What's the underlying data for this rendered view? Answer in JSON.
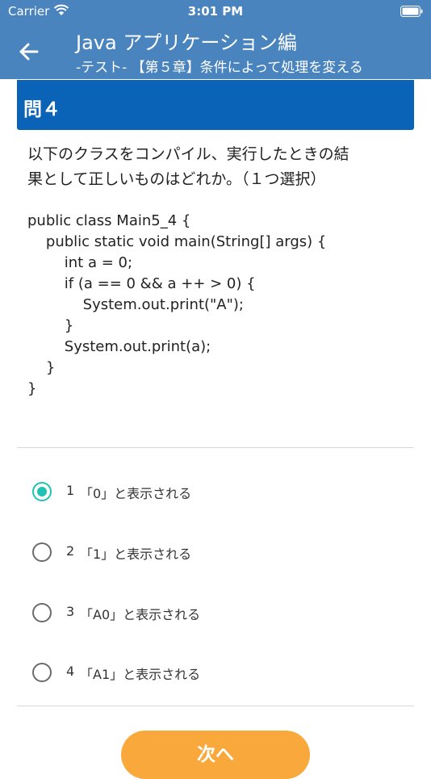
{
  "status_bar": {
    "carrier": "Carrier",
    "time": "3:01 PM",
    "icons": [
      "wifi-icon",
      "battery-icon"
    ]
  },
  "header": {
    "title": "Java アプリケーション編",
    "subtitle": "-テスト- 【第５章】条件によって処理を変える",
    "back_icon": "arrow-left-icon",
    "background": "#4a84be"
  },
  "question": {
    "label": "問４",
    "banner_color": "#0b63b8",
    "text_line1": "以下のクラスをコンパイル、実行したときの結",
    "text_line2": "果として正しいものはどれか。（１つ選択）",
    "code": [
      "public class Main5_4 {",
      "    public static void main(String[] args) {",
      "        int a = 0;",
      "        if (a == 0 && a ++ > 0) {",
      "            System.out.print(\"A\");",
      "        }",
      "        System.out.print(a);",
      "    }",
      "}"
    ]
  },
  "options": [
    {
      "number": "1",
      "label": "「0」と表示される",
      "selected": true
    },
    {
      "number": "2",
      "label": "「1」と表示される",
      "selected": false
    },
    {
      "number": "3",
      "label": "「A0」と表示される",
      "selected": false
    },
    {
      "number": "4",
      "label": "「A1」と表示される",
      "selected": false
    }
  ],
  "selected_color": "#1ec3b3",
  "next_button": {
    "label": "次へ",
    "color": "#f9a93b"
  }
}
